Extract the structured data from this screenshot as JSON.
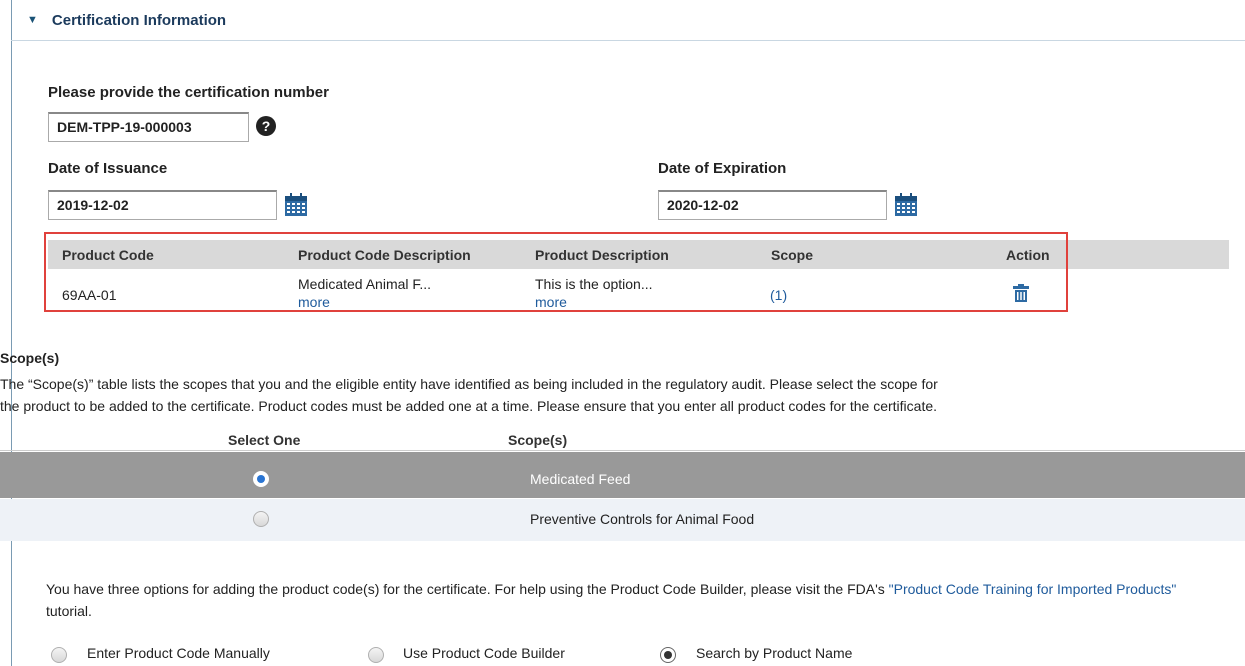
{
  "section": {
    "title": "Certification Information"
  },
  "cert_number": {
    "label": "Please provide the certification number",
    "value": "DEM-TPP-19-000003"
  },
  "issuance": {
    "label": "Date of Issuance",
    "value": "2019-12-02"
  },
  "expiration": {
    "label": "Date of Expiration",
    "value": "2020-12-02"
  },
  "product_table": {
    "headers": [
      "Product Code",
      "Product Code Description",
      "Product Description",
      "Scope",
      "Action"
    ],
    "rows": [
      {
        "code": "69AA-01",
        "code_desc": "Medicated Animal F...",
        "code_desc_more": "more",
        "prod_desc": "This is the option...",
        "prod_desc_more": "more",
        "scope": "(1)"
      }
    ]
  },
  "scopes": {
    "title": "Scope(s)",
    "description_line1": "The “Scope(s)” table lists the scopes that you and the eligible entity have identified as being included in the regulatory audit. Please select the scope for",
    "description_line2": "the product to be added to the certificate. Product codes must be added one at a time. Please ensure that you enter all product codes for the certificate.",
    "headers": [
      "Select One",
      "Scope(s)"
    ],
    "rows": [
      {
        "label": "Medicated Feed",
        "selected": true
      },
      {
        "label": "Preventive Controls for Animal Food",
        "selected": false
      }
    ]
  },
  "options": {
    "text_before": "You have three options for adding the product code(s) for the certificate. For help using the Product Code Builder, please visit the FDA's ",
    "link": "\"Product Code Training for Imported Products\"",
    "text_after": " tutorial.",
    "choices": [
      "Enter Product Code Manually",
      "Use Product Code Builder",
      "Search by Product Name"
    ],
    "selected_index": 2
  },
  "colors": {
    "highlight": "#e0413c",
    "link": "#1f5b9c",
    "selected_row": "#999999"
  }
}
